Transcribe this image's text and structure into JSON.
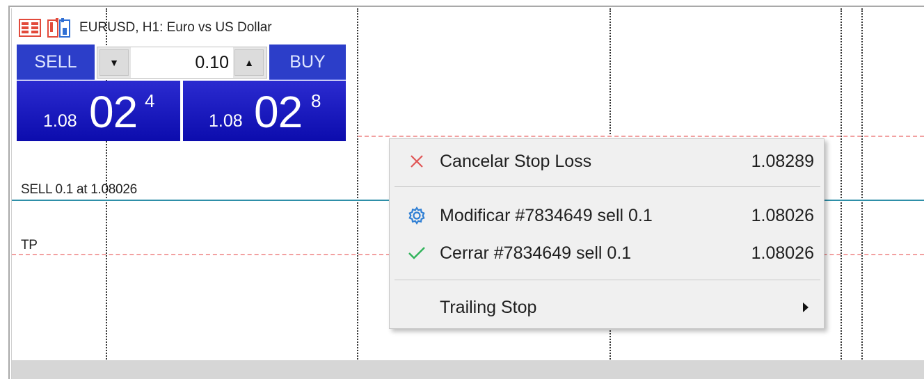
{
  "chart": {
    "title": "EURUSD, H1:  Euro vs US Dollar",
    "position_label": "SELL 0.1 at 1.08026",
    "tp_label": "TP"
  },
  "trade_panel": {
    "sell_label": "SELL",
    "buy_label": "BUY",
    "lot": "0.10",
    "sell_price": {
      "small": "1.08",
      "big": "02",
      "sup": "4"
    },
    "buy_price": {
      "small": "1.08",
      "big": "02",
      "sup": "8"
    }
  },
  "context_menu": {
    "items": [
      {
        "label": "Cancelar Stop Loss",
        "value": "1.08289",
        "icon": "close-icon"
      },
      {
        "label": "Modificar #7834649 sell 0.1",
        "value": "1.08026",
        "icon": "gear-icon"
      },
      {
        "label": "Cerrar #7834649 sell 0.1",
        "value": "1.08026",
        "icon": "check-icon"
      },
      {
        "label": "Trailing Stop",
        "value": "",
        "icon": "chevron-right-icon"
      }
    ]
  },
  "colors": {
    "panel_blue": "#1212b5",
    "position_line": "#2e8fa8",
    "sl_tp_line": "#f2a0a0",
    "close_icon": "#e05555",
    "gear_icon": "#2f7fd4",
    "check_icon": "#2fb35a"
  }
}
